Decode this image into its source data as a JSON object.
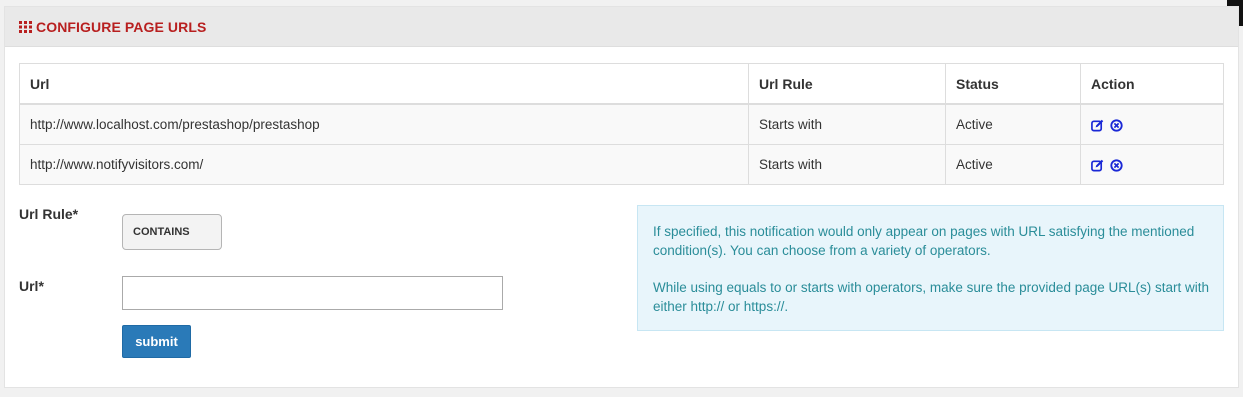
{
  "panel": {
    "title": "CONFIGURE PAGE URLS",
    "title_color": "#b81f1f",
    "icon": "grid-icon"
  },
  "table": {
    "headers": [
      "Url",
      "Url Rule",
      "Status",
      "Action"
    ],
    "rows": [
      {
        "url": "http://www.localhost.com/prestashop/prestashop",
        "rule": "Starts with",
        "status": "Active"
      },
      {
        "url": "http://www.notifyvisitors.com/",
        "rule": "Starts with",
        "status": "Active"
      }
    ],
    "action_icons": [
      "edit-icon",
      "delete-icon"
    ],
    "action_color": "#1a28d6"
  },
  "form": {
    "url_rule_label": "Url Rule*",
    "url_rule_value": "CONTAINS",
    "url_label": "Url*",
    "url_value": "",
    "submit_label": "submit",
    "submit_color": "#2a7ab8"
  },
  "info": {
    "paragraph1": "If specified, this notification would only appear on pages with URL satisfying the mentioned condition(s). You can choose from a variety of operators.",
    "paragraph2": "While using equals to or starts with operators, make sure the provided page URL(s) start with either http:// or https://.",
    "color": "#2a8d99",
    "background": "#e8f5fb"
  }
}
